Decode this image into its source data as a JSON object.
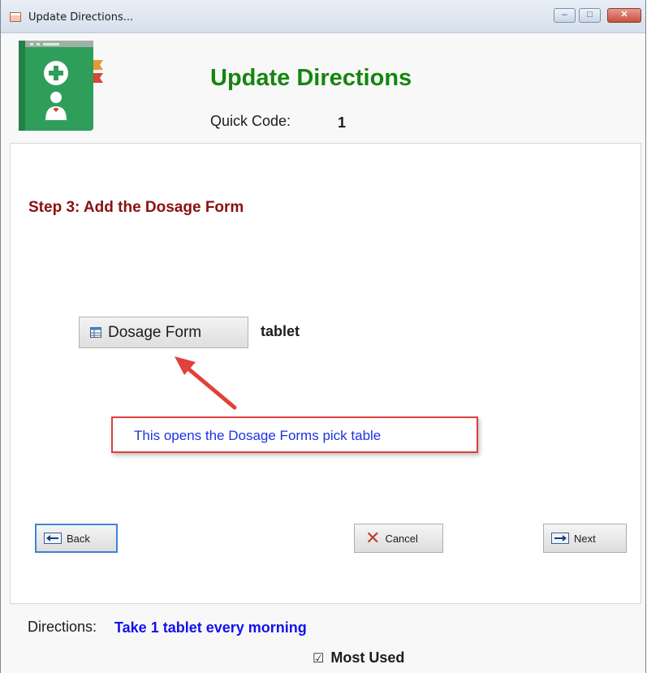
{
  "window": {
    "title": "Update Directions...",
    "minimize_glyph": "–",
    "maximize_glyph": "□",
    "close_glyph": "✕"
  },
  "header": {
    "heading": "Update Directions",
    "quick_code_label": "Quick Code:",
    "quick_code_value": "1",
    "logo_icon": "medical-book-icon"
  },
  "step": {
    "title": "Step 3: Add the Dosage Form"
  },
  "dosage": {
    "button_label": "Dosage Form",
    "value": "tablet"
  },
  "callout": {
    "text": "This opens the Dosage Forms pick table"
  },
  "nav": {
    "back_label": "Back",
    "cancel_label": "Cancel",
    "next_label": "Next"
  },
  "directions": {
    "label": "Directions:",
    "value": "Take 1 tablet every morning"
  },
  "most_used": {
    "label": "Most Used",
    "checked": true,
    "check_glyph": "☑"
  },
  "colors": {
    "heading_green": "#16850f",
    "step_red": "#8b1010",
    "callout_blue": "#1b33e0",
    "callout_border": "#de4040",
    "directions_blue": "#1212e8"
  }
}
